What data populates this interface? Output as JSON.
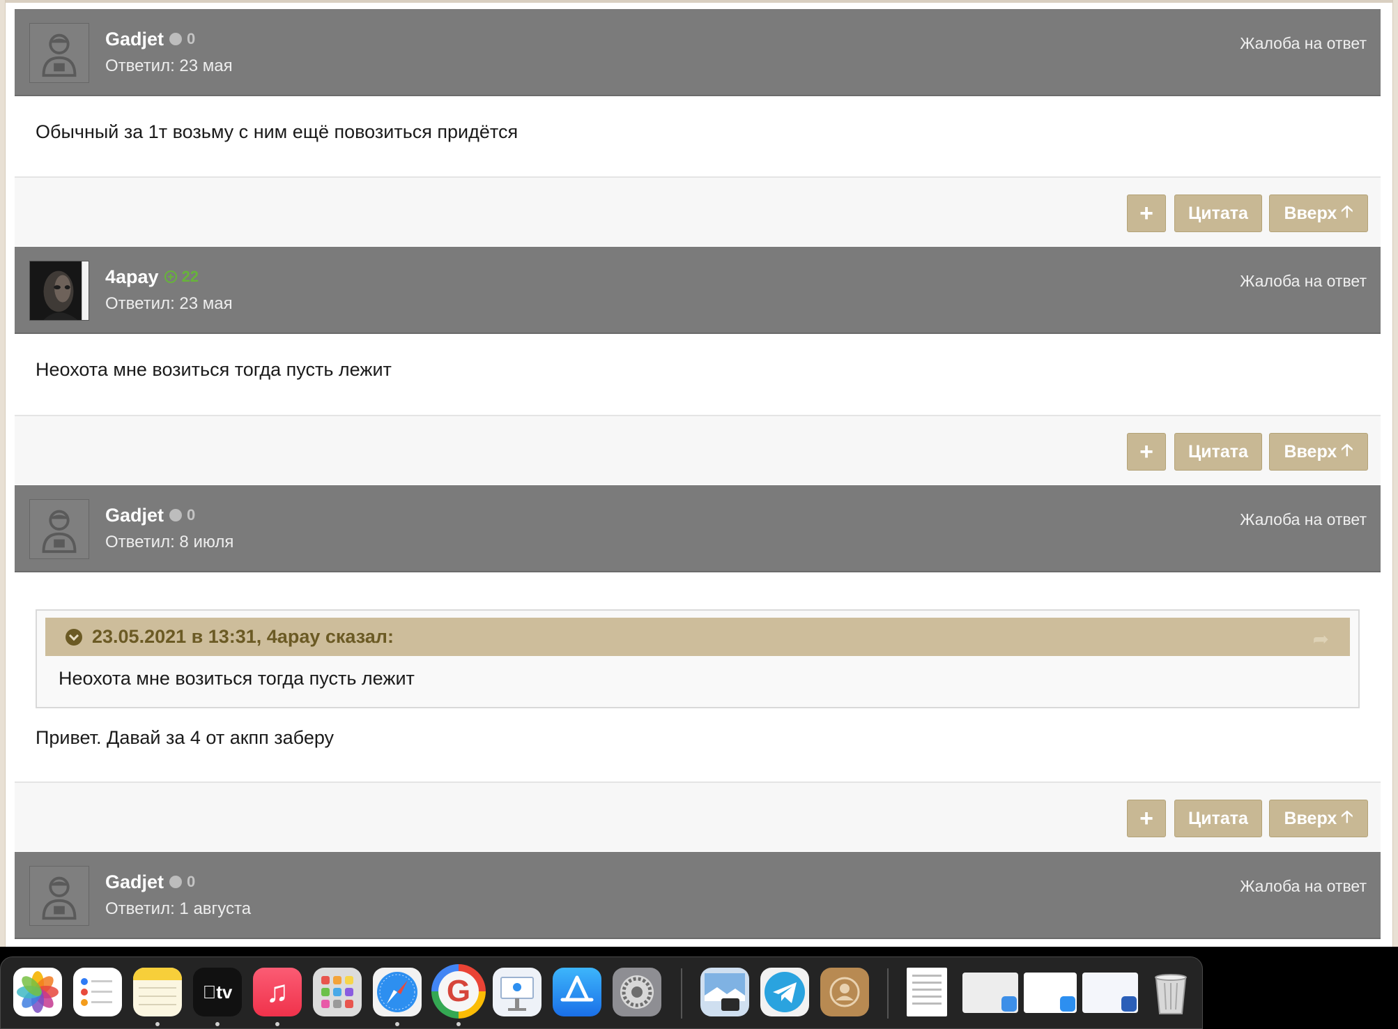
{
  "posts": [
    {
      "username": "Gadjet",
      "reputation": "0",
      "replied": "Ответил: 23 мая",
      "complaint": "Жалоба на ответ",
      "text": "Обычный за 1т возьму с ним ещё повозиться придётся"
    },
    {
      "username": "4apay",
      "reputation": "22",
      "replied": "Ответил: 23 мая",
      "complaint": "Жалоба на ответ",
      "text": "Неохота мне возиться тогда пусть лежит"
    },
    {
      "username": "Gadjet",
      "reputation": "0",
      "replied": "Ответил: 8 июля",
      "complaint": "Жалоба на ответ",
      "quote": {
        "author": "23.05.2021 в 13:31, 4apay сказал:",
        "text": "Неохота мне возиться тогда пусть лежит"
      },
      "text": "Привет. Давай за 4 от акпп заберу"
    },
    {
      "username": "Gadjet",
      "reputation": "0",
      "replied": "Ответил: 1 августа",
      "complaint": "Жалоба на ответ"
    }
  ],
  "actions": {
    "plus": "+",
    "quote": "Цитата",
    "up": "Вверх"
  },
  "colors": {
    "header_bg": "#7b7b7b",
    "button_bg": "#c8b894",
    "quote_head_bg": "#cdbd9b",
    "quote_author": "#6b5a24",
    "positive_rep": "#67b43a"
  },
  "dock": {
    "apps": [
      "photos-icon",
      "reminders-icon",
      "notes-icon",
      "apple-tv-icon",
      "music-icon",
      "launchpad-icon",
      "safari-icon",
      "google-chrome-icon",
      "keynote-icon",
      "app-store-icon",
      "system-preferences-icon",
      "preview-icon",
      "telegram-icon",
      "contacts-icon",
      "document-icon",
      "finder-window-icon",
      "mail-window-icon",
      "word-window-icon",
      "trash-icon"
    ],
    "tv_label": "tv"
  }
}
